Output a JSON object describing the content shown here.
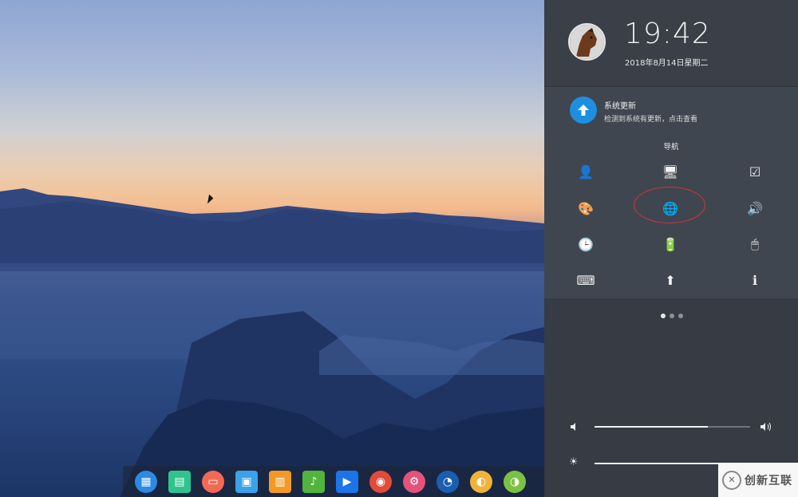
{
  "panel": {
    "time": "19:42",
    "date": "2018年8月14日星期二",
    "notification": {
      "title": "系统更新",
      "body": "检测到系统有更新，点击查看"
    },
    "section_title": "导航",
    "grid_items": [
      {
        "name": "account",
        "icon": "user-icon",
        "glyph": "👤"
      },
      {
        "name": "display",
        "icon": "monitor-icon",
        "glyph": "🖥"
      },
      {
        "name": "default-apps",
        "icon": "calendar-check-icon",
        "glyph": "☑"
      },
      {
        "name": "personalization",
        "icon": "palette-icon",
        "glyph": "🎨"
      },
      {
        "name": "network",
        "icon": "globe-icon",
        "glyph": "🌐"
      },
      {
        "name": "sound",
        "icon": "speaker-icon",
        "glyph": "🔊"
      },
      {
        "name": "time-date",
        "icon": "clock-icon",
        "glyph": "🕒"
      },
      {
        "name": "power",
        "icon": "battery-icon",
        "glyph": "🔋"
      },
      {
        "name": "mouse",
        "icon": "mouse-icon",
        "glyph": "🖱"
      },
      {
        "name": "keyboard",
        "icon": "keyboard-icon",
        "glyph": "⌨"
      },
      {
        "name": "update",
        "icon": "upload-arrow-icon",
        "glyph": "⬆"
      },
      {
        "name": "system-info",
        "icon": "info-icon",
        "glyph": "ℹ"
      }
    ],
    "pager": {
      "pages": 3,
      "current": 1
    },
    "volume": {
      "level": 0.73
    },
    "brightness": {
      "level": 0.98
    }
  },
  "dock": {
    "apps": [
      {
        "name": "launcher",
        "icon": "launcher-icon",
        "color": "#2a8ae4",
        "glyph": "▦"
      },
      {
        "name": "file-manager",
        "icon": "folder-icon",
        "color": "#2fc48d",
        "glyph": "▤"
      },
      {
        "name": "video-player",
        "icon": "video-icon",
        "color": "#f26a55",
        "glyph": "▭"
      },
      {
        "name": "app-store",
        "icon": "store-icon",
        "color": "#3aa2e8",
        "glyph": "▣"
      },
      {
        "name": "gift-app",
        "icon": "gift-icon",
        "color": "#f39a26",
        "glyph": "▥"
      },
      {
        "name": "music",
        "icon": "music-icon",
        "color": "#53b43d",
        "glyph": "♪"
      },
      {
        "name": "movie",
        "icon": "movie-icon",
        "color": "#1b74e8",
        "glyph": "▶"
      },
      {
        "name": "chrome",
        "icon": "chrome-icon",
        "color": "#e24a3a",
        "glyph": "◉"
      },
      {
        "name": "settings",
        "icon": "gear-icon",
        "color": "#e5527a",
        "glyph": "⚙"
      },
      {
        "name": "monitor",
        "icon": "gauge-icon",
        "color": "#1a5fae",
        "glyph": "◔"
      },
      {
        "name": "browser",
        "icon": "browser-icon",
        "color": "#f0b33a",
        "glyph": "◐"
      },
      {
        "name": "extra",
        "icon": "app-icon",
        "color": "#7cc242",
        "glyph": "◑"
      }
    ]
  },
  "watermark": {
    "text": "创新互联",
    "logo": "✕"
  },
  "colors": {
    "panel_bg": "#363b44",
    "notification_bg": "#404650",
    "update_icon_bg": "#1e8fe0",
    "highlight_ellipse": "#d2343a"
  }
}
